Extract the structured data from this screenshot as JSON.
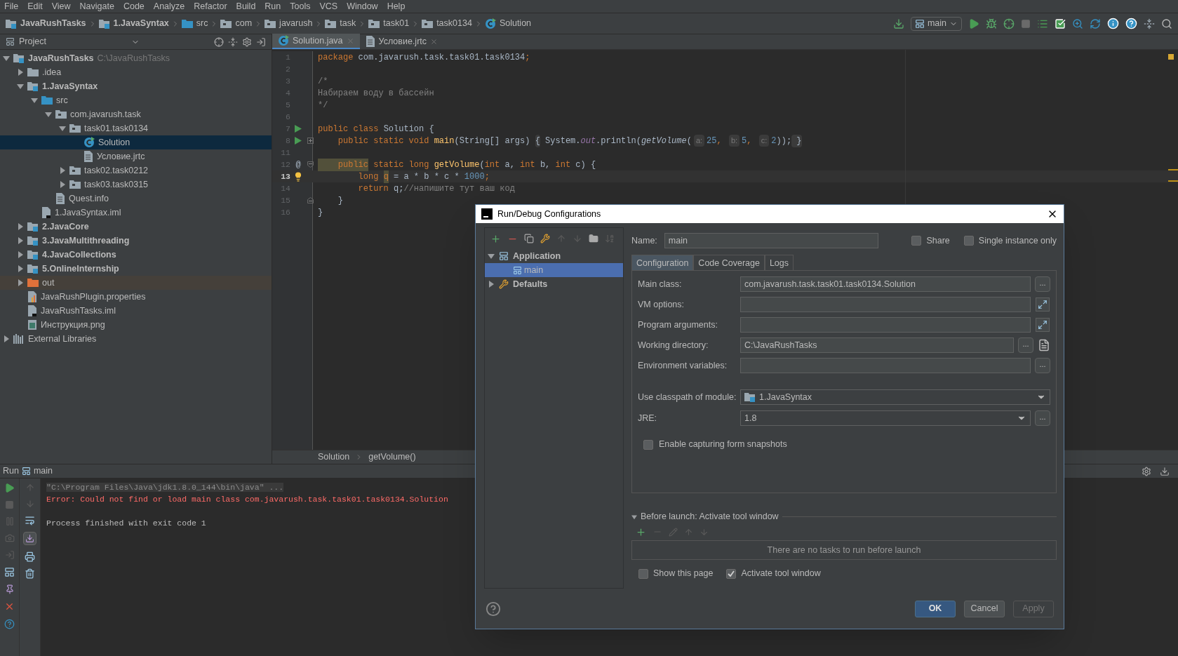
{
  "menu": [
    "File",
    "Edit",
    "View",
    "Navigate",
    "Code",
    "Analyze",
    "Refactor",
    "Build",
    "Run",
    "Tools",
    "VCS",
    "Window",
    "Help"
  ],
  "breadcrumbs": [
    {
      "label": "JavaRushTasks",
      "kind": "module"
    },
    {
      "label": "1.JavaSyntax",
      "kind": "module"
    },
    {
      "label": "src",
      "kind": "source"
    },
    {
      "label": "com",
      "kind": "package"
    },
    {
      "label": "javarush",
      "kind": "package"
    },
    {
      "label": "task",
      "kind": "package"
    },
    {
      "label": "task01",
      "kind": "package"
    },
    {
      "label": "task0134",
      "kind": "package"
    },
    {
      "label": "Solution",
      "kind": "class"
    }
  ],
  "run_config": "main",
  "project": {
    "title": "Project",
    "tree": [
      {
        "label": "JavaRushTasks",
        "kind": "project",
        "hint": "C:\\JavaRushTasks",
        "expanded": true,
        "selected": false,
        "children": [
          {
            "label": ".idea",
            "kind": "folder",
            "expanded": false,
            "selected": false
          },
          {
            "label": "1.JavaSyntax",
            "kind": "module",
            "expanded": true,
            "selected": false,
            "children": [
              {
                "label": "src",
                "kind": "source",
                "expanded": true,
                "selected": false,
                "children": [
                  {
                    "label": "com.javarush.task",
                    "kind": "package",
                    "expanded": true,
                    "selected": false,
                    "children": [
                      {
                        "label": "task01.task0134",
                        "kind": "package",
                        "expanded": true,
                        "selected": false,
                        "children": [
                          {
                            "label": "Solution",
                            "kind": "class",
                            "selected": true
                          },
                          {
                            "label": "Условие.jrtc",
                            "kind": "file",
                            "selected": false
                          }
                        ]
                      },
                      {
                        "label": "task02.task0212",
                        "kind": "package",
                        "expanded": false,
                        "selected": false
                      },
                      {
                        "label": "task03.task0315",
                        "kind": "package",
                        "expanded": false,
                        "selected": false
                      }
                    ]
                  },
                  {
                    "label": "Quest.info",
                    "kind": "file",
                    "selected": false
                  }
                ]
              },
              {
                "label": "1.JavaSyntax.iml",
                "kind": "iml",
                "selected": false
              }
            ]
          },
          {
            "label": "2.JavaCore",
            "kind": "module",
            "expanded": false,
            "selected": false
          },
          {
            "label": "3.JavaMultithreading",
            "kind": "module",
            "expanded": false,
            "selected": false
          },
          {
            "label": "4.JavaCollections",
            "kind": "module",
            "expanded": false,
            "selected": false
          },
          {
            "label": "5.OnlineInternship",
            "kind": "module",
            "expanded": false,
            "selected": false
          },
          {
            "label": "out",
            "kind": "excluded",
            "expanded": false,
            "selected": false
          },
          {
            "label": "JavaRushPlugin.properties",
            "kind": "properties",
            "selected": false
          },
          {
            "label": "JavaRushTasks.iml",
            "kind": "iml",
            "selected": false
          },
          {
            "label": "Инструкция.png",
            "kind": "image",
            "selected": false
          }
        ]
      },
      {
        "label": "External Libraries",
        "kind": "libraries",
        "expanded": false,
        "selected": false
      }
    ]
  },
  "editor": {
    "tabs": [
      {
        "label": "Solution.java",
        "kind": "class",
        "selected": true
      },
      {
        "label": "Условие.jrtc",
        "kind": "file",
        "selected": false
      }
    ],
    "lines": [
      {
        "number": "1",
        "current": false,
        "tokens": [
          {
            "text": "package",
            "kind": "kw"
          },
          {
            "text": " com.javarush.task.task01.task0134",
            "kind": "plain"
          },
          {
            "text": ";",
            "kind": "kw"
          }
        ]
      },
      {
        "number": "2",
        "current": false
      },
      {
        "number": "3",
        "current": false,
        "tokens": [
          {
            "text": "/*",
            "kind": "comment"
          }
        ]
      },
      {
        "number": "4",
        "current": false,
        "tokens": [
          {
            "text": "Набираем воду в бассейн",
            "kind": "comment"
          }
        ]
      },
      {
        "number": "5",
        "current": false,
        "tokens": [
          {
            "text": "*/",
            "kind": "comment"
          }
        ]
      },
      {
        "number": "6",
        "current": false
      },
      {
        "number": "7",
        "current": false,
        "marker": {
          "kind": "run"
        },
        "tokens": [
          {
            "text": "public class ",
            "kind": "kw"
          },
          {
            "text": "Solution {",
            "kind": "plain"
          }
        ]
      },
      {
        "number": "8",
        "current": false,
        "marker": {
          "kind": "run"
        },
        "fold": {
          "kind": "collapsed"
        },
        "tokens": [
          {
            "text": "    public static void ",
            "kind": "kw"
          },
          {
            "text": "main",
            "kind": "method"
          },
          {
            "text": "(String[] args) ",
            "kind": "plain"
          },
          {
            "text": "{",
            "kind": "fold"
          },
          {
            "text": " System.",
            "kind": "plain"
          },
          {
            "text": "out",
            "kind": "static"
          },
          {
            "text": ".println(",
            "kind": "plain"
          },
          {
            "text": "getVolume",
            "kind": "italic"
          },
          {
            "text": "(",
            "kind": "plain"
          },
          {
            "text": "a:",
            "kind": "hint"
          },
          {
            "text": "25",
            "kind": "num"
          },
          {
            "text": ", ",
            "kind": "kw"
          },
          {
            "text": "b:",
            "kind": "hint"
          },
          {
            "text": "5",
            "kind": "num"
          },
          {
            "text": ", ",
            "kind": "kw"
          },
          {
            "text": "c:",
            "kind": "hint"
          },
          {
            "text": "2",
            "kind": "num"
          },
          {
            "text": "));",
            "kind": "plain"
          },
          {
            "text": " }",
            "kind": "fold"
          }
        ]
      },
      {
        "number": "11",
        "current": false
      },
      {
        "number": "12",
        "current": false,
        "marker": {
          "kind": "override",
          "text": "@"
        },
        "fold": {
          "kind": "open"
        },
        "tokens": [
          {
            "text": "    public",
            "kind": "marked"
          },
          {
            "text": " static long ",
            "kind": "kw"
          },
          {
            "text": "getVolume",
            "kind": "method"
          },
          {
            "text": "(",
            "kind": "plain"
          },
          {
            "text": "int ",
            "kind": "kw"
          },
          {
            "text": "a, ",
            "kind": "plain"
          },
          {
            "text": "int ",
            "kind": "kw"
          },
          {
            "text": "b, ",
            "kind": "plain"
          },
          {
            "text": "int ",
            "kind": "kw"
          },
          {
            "text": "c) {",
            "kind": "plain"
          }
        ]
      },
      {
        "number": "13",
        "current": true,
        "marker": {
          "kind": "bulb"
        },
        "tokens": [
          {
            "text": "        long ",
            "kind": "kw"
          },
          {
            "text": "q",
            "kind": "marked"
          },
          {
            "text": " = a * b * c * ",
            "kind": "plain"
          },
          {
            "text": "1000",
            "kind": "num"
          },
          {
            "text": ";",
            "kind": "kw"
          }
        ]
      },
      {
        "number": "14",
        "current": false,
        "tokens": [
          {
            "text": "        return ",
            "kind": "kw"
          },
          {
            "text": "q;",
            "kind": "plain"
          },
          {
            "text": "//напишите тут ваш код",
            "kind": "comment"
          }
        ]
      },
      {
        "number": "15",
        "current": false,
        "fold": {
          "kind": "end"
        },
        "tokens": [
          {
            "text": "    }",
            "kind": "plain"
          }
        ]
      },
      {
        "number": "16",
        "current": false,
        "tokens": [
          {
            "text": "}",
            "kind": "plain"
          }
        ]
      }
    ],
    "breadcrumb": [
      "Solution",
      "getVolume()"
    ]
  },
  "run_panel": {
    "title": "Run",
    "config": "main",
    "console": [
      {
        "text": "\"C:\\Program Files\\Java\\jdk1.8.0_144\\bin\\java\" ...",
        "kind": "command"
      },
      {
        "text": "Error: Could not find or load main class com.javarush.task.task01.task0134.Solution",
        "kind": "error"
      }
    ],
    "exit_message": "Process finished with exit code 1"
  },
  "dialog": {
    "title": "Run/Debug Configurations",
    "tree": [
      {
        "label": "Application",
        "expanded": true,
        "selected": false,
        "children": [
          {
            "label": "main",
            "selected": true
          }
        ]
      },
      {
        "label": "Defaults",
        "expanded": false,
        "selected": false
      }
    ],
    "name_label": "Name:",
    "name_value": "main",
    "options": [
      {
        "label": "Share",
        "checked": false
      },
      {
        "label": "Single instance only",
        "checked": false
      }
    ],
    "tabs": [
      {
        "label": "Configuration",
        "selected": true
      },
      {
        "label": "Code Coverage",
        "selected": false
      },
      {
        "label": "Logs",
        "selected": false
      }
    ],
    "fields": [
      {
        "label": "Main class:",
        "value": "com.javarush.task.task01.task0134.Solution",
        "kind": "text",
        "buttons": [
          {
            "kind": "browse",
            "label": "..."
          }
        ]
      },
      {
        "label": "VM options:",
        "kind": "text",
        "buttons": [
          {
            "kind": "expand"
          }
        ]
      },
      {
        "label": "Program arguments:",
        "kind": "text",
        "buttons": [
          {
            "kind": "expand"
          }
        ]
      },
      {
        "label": "Working directory:",
        "value": "C:\\JavaRushTasks",
        "kind": "text",
        "buttons": [
          {
            "kind": "browse",
            "label": "..."
          },
          {
            "kind": "document"
          }
        ]
      },
      {
        "label": "Environment variables:",
        "kind": "text",
        "buttons": [
          {
            "kind": "browse",
            "label": "..."
          }
        ]
      }
    ],
    "module_fields": [
      {
        "label": "Use classpath of module:",
        "value": "1.JavaSyntax",
        "kind": "module-combo"
      },
      {
        "label": "JRE:",
        "value": "1.8",
        "kind": "combo",
        "buttons": [
          {
            "kind": "browse",
            "label": "..."
          }
        ]
      }
    ],
    "snapshots": {
      "label": "Enable capturing form snapshots",
      "checked": false
    },
    "before_launch": {
      "label": "Before launch: Activate tool window",
      "expanded": true,
      "empty_text": "There are no tasks to run before launch"
    },
    "bottom_options": [
      {
        "label": "Show this page",
        "checked": false
      },
      {
        "label": "Activate tool window",
        "checked": true
      }
    ],
    "buttons": [
      {
        "label": "OK",
        "kind": "default",
        "disabled": false
      },
      {
        "label": "Cancel",
        "kind": "normal",
        "disabled": false
      },
      {
        "label": "Apply",
        "kind": "normal",
        "disabled": true
      }
    ]
  }
}
